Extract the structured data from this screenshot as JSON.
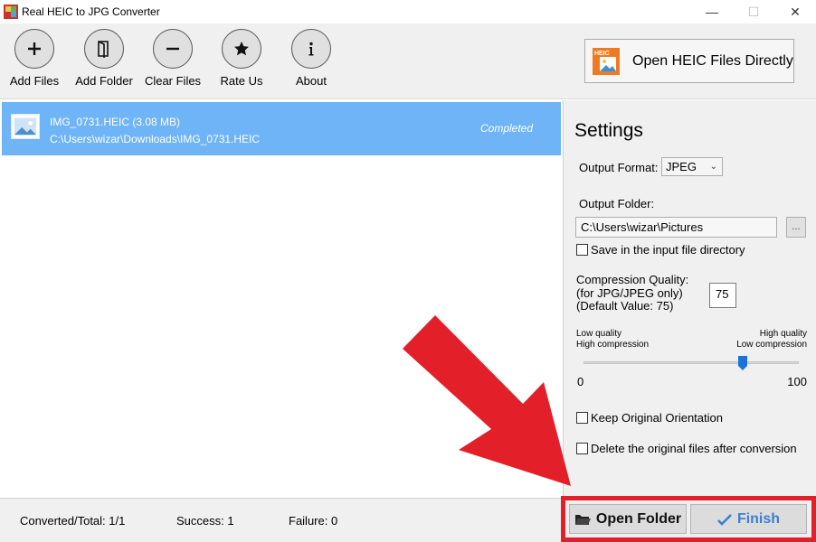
{
  "window": {
    "title": "Real HEIC to JPG Converter",
    "controls": {
      "minimize": "—",
      "maximize": "☐",
      "close": "✕"
    }
  },
  "toolbar": {
    "add_files": "Add Files",
    "add_folder": "Add Folder",
    "clear_files": "Clear Files",
    "rate_us": "Rate Us",
    "about": "About",
    "open_heic": "Open HEIC Files Directly",
    "heic_badge": "HEIC"
  },
  "file_list": [
    {
      "name": "IMG_0731.HEIC (3.08 MB)",
      "path": "C:\\Users\\wizar\\Downloads\\IMG_0731.HEIC",
      "status": "Completed"
    }
  ],
  "settings": {
    "title": "Settings",
    "output_format_label": "Output Format:",
    "output_format_value": "JPEG",
    "output_folder_label": "Output Folder:",
    "output_folder_value": "C:\\Users\\wizar\\Pictures",
    "browse_label": "...",
    "save_in_input_dir": "Save in the input file directory",
    "compression_line1": "Compression Quality:",
    "compression_line2": "(for JPG/JPEG only)",
    "compression_line3": "(Default Value: 75)",
    "quality_value": "75",
    "low_quality": "Low quality",
    "high_compression": "High compression",
    "high_quality": "High quality",
    "low_compression": "Low compression",
    "slider_min": "0",
    "slider_max": "100",
    "slider_value": 75,
    "keep_orientation": "Keep Original Orientation",
    "delete_originals": "Delete the original files after conversion"
  },
  "status": {
    "converted_total": "Converted/Total:  1/1",
    "success": "Success:  1",
    "failure": "Failure:  0"
  },
  "actions": {
    "open_folder": "Open Folder",
    "finish": "Finish"
  },
  "colors": {
    "selected_row": "#6eb4f7",
    "highlight_red": "#e3202a",
    "finish_blue": "#3c7fd1",
    "panel_bg": "#f0f0f0"
  },
  "icons": [
    "app-icon",
    "plus-icon",
    "folder-icon",
    "minus-icon",
    "star-icon",
    "info-icon",
    "heic-file-icon",
    "image-thumbnail-icon",
    "folder-open-icon",
    "checkmark-icon",
    "red-arrow"
  ]
}
